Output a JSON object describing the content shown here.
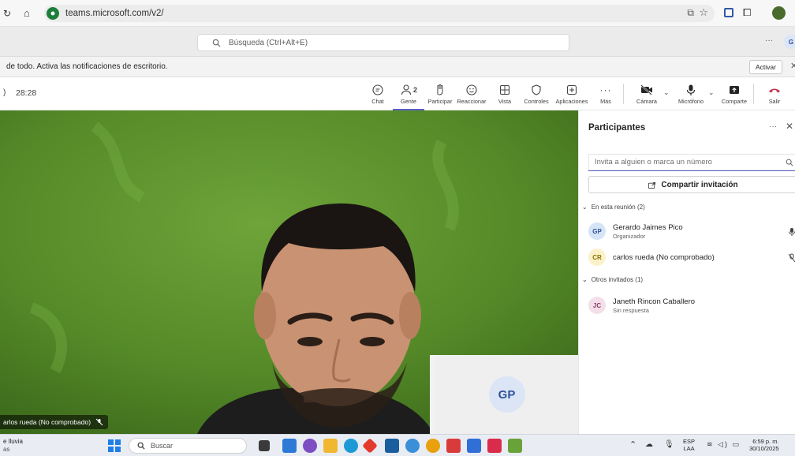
{
  "browser": {
    "url": "teams.microsoft.com/v2/"
  },
  "teams": {
    "search_placeholder": "Búsqueda (Ctrl+Alt+E)",
    "more": "···",
    "account_initial": "G"
  },
  "notification": {
    "text": "de todo. Activa las notificaciones de escritorio.",
    "button": "Activar"
  },
  "meeting": {
    "timer": "28:28",
    "toolbar": [
      {
        "label": "Chat",
        "icon": "chat-icon"
      },
      {
        "label": "Gente",
        "icon": "people-icon",
        "count": "2"
      },
      {
        "label": "Participar",
        "icon": "raise-hand-icon"
      },
      {
        "label": "Reaccionar",
        "icon": "smile-icon"
      },
      {
        "label": "Vista",
        "icon": "grid-icon"
      },
      {
        "label": "Controles",
        "icon": "shield-icon"
      },
      {
        "label": "Aplicaciones",
        "icon": "plus-box-icon"
      },
      {
        "label": "Más",
        "icon": "more-icon"
      }
    ],
    "camera_label": "Cámara",
    "mic_label": "Micrófono",
    "share_label": "Comparte",
    "leave_label": "Salir",
    "speaker_label": "arlos rueda (No comprobado)",
    "self_initials": "GP"
  },
  "panel": {
    "title": "Participantes",
    "invite_placeholder": "Invita a alguien o marca un número",
    "share_invite": "Compartir invitación",
    "in_meeting_header": "En esta reunión (2)",
    "others_header": "Otros invitados (1)",
    "participants": [
      {
        "initials": "GP",
        "name": "Gerardo Jaimes Pico",
        "role": "Organizador",
        "color": "#d6e4f7",
        "text_color": "#2f5496"
      },
      {
        "initials": "CR",
        "name": "carlos rueda (No comprobado)",
        "role": "",
        "color": "#fbf2c9",
        "text_color": "#8a6d00"
      }
    ],
    "invited": [
      {
        "initials": "JC",
        "name": "Janeth Rincon Caballero",
        "status": "Sin respuesta",
        "color": "#f3dfe9",
        "text_color": "#8b3b67"
      }
    ]
  },
  "taskbar": {
    "weather_line1": "e lluvia",
    "weather_line2": "as",
    "search": "Buscar",
    "lang1": "ESP",
    "lang2": "LAA",
    "time": "6:59 p. m.",
    "date": "30/10/2025"
  }
}
